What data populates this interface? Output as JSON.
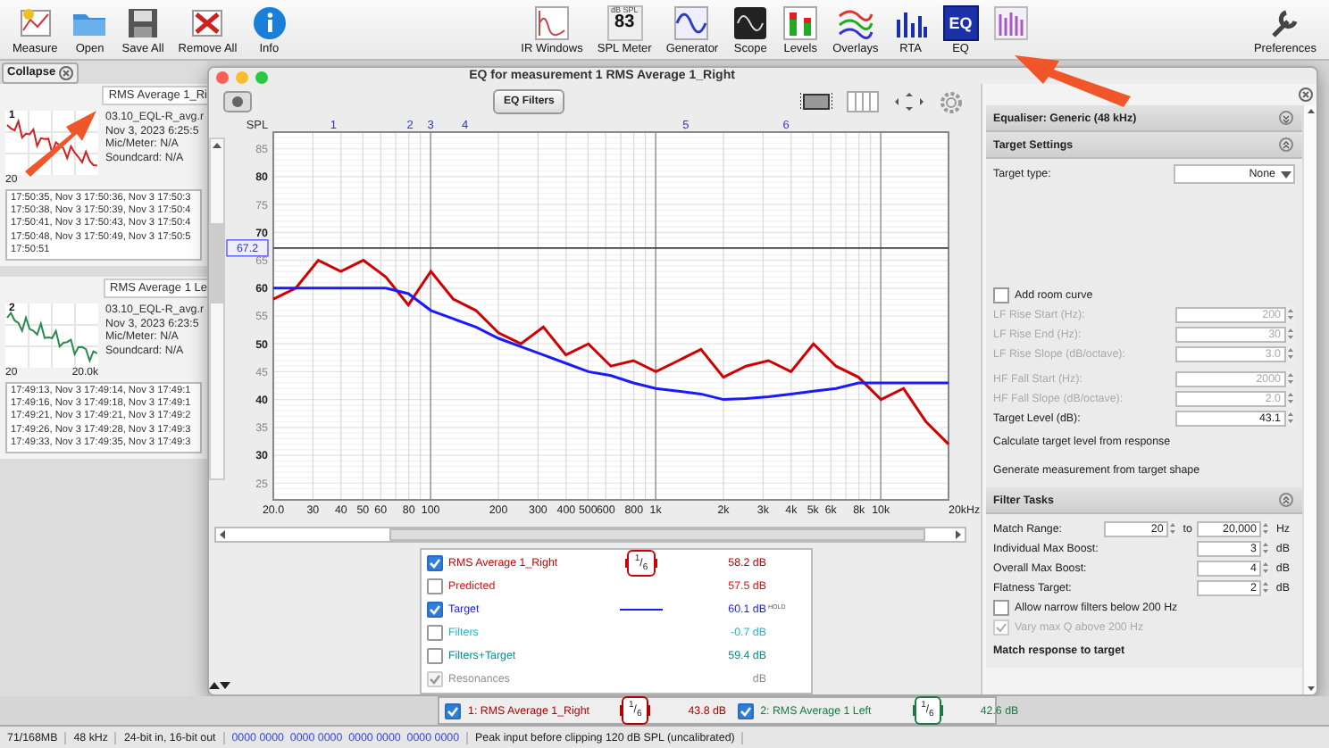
{
  "toolbar": {
    "left": [
      {
        "label": "Measure"
      },
      {
        "label": "Open"
      },
      {
        "label": "Save All"
      },
      {
        "label": "Remove All"
      },
      {
        "label": "Info"
      }
    ],
    "center": [
      {
        "label": "IR Windows"
      },
      {
        "label": "SPL Meter",
        "icon_texts": [
          "dB SPL",
          "83"
        ]
      },
      {
        "label": "Generator"
      },
      {
        "label": "Scope"
      },
      {
        "label": "Levels"
      },
      {
        "label": "Overlays"
      },
      {
        "label": "RTA"
      },
      {
        "label": "EQ",
        "icon_texts": [
          "EQ"
        ]
      }
    ],
    "right": [
      {
        "label": "Preferences"
      }
    ]
  },
  "sidebar": {
    "collapse": "Collapse",
    "measurements": [
      {
        "number": "1",
        "title": "RMS Average 1_Ri",
        "color": "#d42020",
        "axis": [
          "20"
        ],
        "info": [
          "03.10_EQL-R_avg.r",
          "Nov 3, 2023 6:25:5",
          "Mic/Meter: N/A",
          "Soundcard: N/A"
        ],
        "log": [
          "17:50:35, Nov 3 17:50:36, Nov 3 17:50:3",
          "17:50:38, Nov 3 17:50:39, Nov 3 17:50:4",
          "17:50:41, Nov 3 17:50:43, Nov 3 17:50:4",
          "17:50:48, Nov 3 17:50:49, Nov 3 17:50:5",
          "17:50:51"
        ]
      },
      {
        "number": "2",
        "title": "RMS Average 1 Le",
        "color": "#2a8a50",
        "axis": [
          "20",
          "20.0k"
        ],
        "info": [
          "03.10_EQL-R_avg.r",
          "Nov 3, 2023 6:23:5",
          "Mic/Meter: N/A",
          "Soundcard: N/A"
        ],
        "log": [
          "17:49:13, Nov 3 17:49:14, Nov 3 17:49:1",
          "17:49:16, Nov 3 17:49:18, Nov 3 17:49:1",
          "17:49:21, Nov 3 17:49:21, Nov 3 17:49:2",
          "17:49:26, Nov 3 17:49:28, Nov 3 17:49:3",
          "17:49:33, Nov 3 17:49:35, Nov 3 17:49:3"
        ]
      }
    ]
  },
  "eq_window": {
    "title": "EQ for measurement 1 RMS Average 1_Right",
    "filters_button": "EQ Filters",
    "filter_markers": [
      "1",
      "2",
      "3",
      "4",
      "5",
      "6"
    ],
    "frequency_labels": [
      "20.0",
      "30",
      "40",
      "50",
      "60",
      "80",
      "100",
      "200",
      "300",
      "400",
      "500",
      "600",
      "800",
      "1k",
      "2k",
      "3k",
      "4k",
      "5k",
      "6k",
      "8k",
      "10k",
      "20kHz"
    ],
    "chart_data": {
      "type": "line",
      "ylabel": "SPL",
      "categories": [
        null,
        null,
        null,
        null,
        null,
        null,
        null,
        null,
        null,
        null,
        null,
        null,
        null,
        null,
        null,
        null,
        null,
        null,
        null,
        null,
        null,
        null,
        null,
        null,
        null,
        null,
        null,
        null,
        null,
        null,
        null
      ],
      "series": [
        {
          "color": "#d00000",
          "values": [
            58,
            60,
            65,
            63,
            65,
            62,
            57,
            63,
            58,
            56,
            52,
            50,
            53,
            48,
            50,
            46,
            47,
            45,
            47,
            49,
            44,
            46,
            47,
            45,
            50,
            46,
            44,
            40,
            42,
            36,
            32
          ]
        },
        {
          "color": "#1a1aff",
          "values": [
            60,
            60,
            60,
            60,
            60,
            60,
            59,
            56,
            54.5,
            53,
            51,
            49.5,
            48,
            46.5,
            45,
            44.3,
            43,
            42,
            41.5,
            41,
            40,
            40.2,
            40.5,
            41,
            41.5,
            42,
            43,
            43,
            43,
            43,
            43
          ]
        }
      ],
      "ylim": [
        22,
        88
      ],
      "grid": true,
      "ref_lines": [
        {
          "axis": "y",
          "value": 67.2,
          "label": "67.2"
        }
      ],
      "yticks": [
        25,
        30,
        35,
        40,
        45,
        50,
        55,
        60,
        65,
        70,
        75,
        80,
        85
      ]
    },
    "legend": [
      {
        "label": "RMS Average 1_Right",
        "color": "#cc0000",
        "checked": true,
        "disabled": false,
        "kind": "smoothing",
        "smoothing": "$^{1}$/$_{6}$",
        "value": "58.2 dB"
      },
      {
        "label": "Predicted",
        "color": "#e01010",
        "checked": false,
        "disabled": false,
        "kind": "none",
        "value": "57.5 dB"
      },
      {
        "label": "Target",
        "color": "#1a1aff",
        "checked": true,
        "disabled": false,
        "kind": "line",
        "value": "60.1 dB",
        "note": "HOLD"
      },
      {
        "label": "Filters",
        "color": "#20b8cc",
        "checked": false,
        "disabled": false,
        "kind": "none",
        "value": "-0.7 dB"
      },
      {
        "label": "Filters+Target",
        "color": "#008f8f",
        "checked": false,
        "disabled": false,
        "kind": "none",
        "value": "59.4 dB"
      },
      {
        "label": "Resonances",
        "color": "#909090",
        "checked": true,
        "disabled": true,
        "kind": "none",
        "value": "dB"
      }
    ]
  },
  "eq_panel": {
    "equaliser": "Equaliser: Generic (48 kHz)",
    "target_settings": {
      "title": "Target Settings",
      "items": [
        {
          "kind": "dropdown",
          "label": "Target type:",
          "value": "None"
        },
        {
          "kind": "spacer"
        },
        {
          "kind": "checkbox",
          "label": "Add room curve",
          "checked": false,
          "disabled": false
        },
        {
          "kind": "number",
          "label": "LF Rise Start (Hz):",
          "value": "200",
          "disabled": true
        },
        {
          "kind": "number",
          "label": "LF Rise End (Hz):",
          "value": "30",
          "disabled": true
        },
        {
          "kind": "number",
          "label": "LF Rise Slope (dB/octave):",
          "value": "3.0",
          "disabled": true
        },
        {
          "kind": "number",
          "label": "HF Fall Start (Hz):",
          "value": "2000",
          "disabled": true
        },
        {
          "kind": "number",
          "label": "HF Fall Slope (dB/octave):",
          "value": "2.0",
          "disabled": true
        },
        {
          "kind": "number",
          "label": "Target Level (dB):",
          "value": "43.1",
          "disabled": false
        },
        {
          "kind": "action",
          "label": "Calculate target level from response"
        },
        {
          "kind": "action",
          "label": "Generate measurement from target shape"
        }
      ]
    },
    "filter_tasks": {
      "title": "Filter Tasks",
      "items": [
        {
          "kind": "range",
          "label": "Match Range:",
          "value": "20",
          "to_label": "to",
          "to": "20,000",
          "unit": "Hz"
        },
        {
          "kind": "number",
          "label": "Individual Max Boost:",
          "value": "3",
          "unit": "dB",
          "disabled": false
        },
        {
          "kind": "number",
          "label": "Overall Max Boost:",
          "value": "4",
          "unit": "dB",
          "disabled": false
        },
        {
          "kind": "number",
          "label": "Flatness Target:",
          "value": "2",
          "unit": "dB",
          "disabled": false
        },
        {
          "kind": "checkbox",
          "label": "Allow narrow filters below 200 Hz",
          "checked": false,
          "disabled": false
        },
        {
          "kind": "checkbox",
          "label": "Vary max Q above 200 Hz",
          "checked": true,
          "disabled": true
        },
        {
          "kind": "action",
          "label": "Match response to target"
        }
      ]
    }
  },
  "bottom_legend": [
    {
      "label": "1: RMS Average 1_Right",
      "color": "#b00000",
      "checked": true,
      "smoothing": "$^{1}$/$_{6}$",
      "value": "43.8 dB"
    },
    {
      "label": "2: RMS Average 1 Left",
      "color": "#1a7a40",
      "checked": true,
      "smoothing": "$^{1}$/$_{6}$",
      "value": "42.6 dB"
    }
  ],
  "status_bar": [
    "71/168MB",
    "48 kHz",
    "24-bit in, 16-bit out",
    "0000 0000  0000 0000  0000 0000  0000 0000",
    "Peak input before clipping 120 dB SPL (uncalibrated)"
  ]
}
